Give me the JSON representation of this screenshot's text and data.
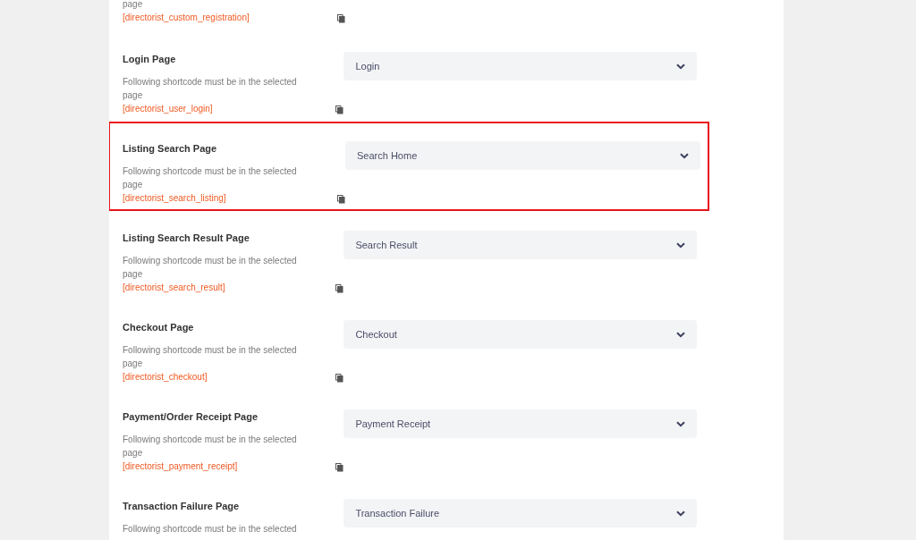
{
  "settings": [
    {
      "description": "page",
      "shortcode": "[directorist_custom_registration]",
      "highlighted": false
    },
    {
      "title": "Login Page",
      "description": "Following shortcode must be in the selected page",
      "shortcode": "[directorist_user_login]",
      "selected_page": "Login",
      "highlighted": false
    },
    {
      "title": "Listing Search Page",
      "description": "Following shortcode must be in the selected page",
      "shortcode": "[directorist_search_listing]",
      "selected_page": "Search Home",
      "highlighted": true
    },
    {
      "title": "Listing Search Result Page",
      "description": "Following shortcode must be in the selected page",
      "shortcode": "[directorist_search_result]",
      "selected_page": "Search Result",
      "highlighted": false
    },
    {
      "title": "Checkout Page",
      "description": "Following shortcode must be in the selected page",
      "shortcode": "[directorist_checkout]",
      "selected_page": "Checkout",
      "highlighted": false
    },
    {
      "title": "Payment/Order Receipt Page",
      "description": "Following shortcode must be in the selected page",
      "shortcode": "[directorist_payment_receipt]",
      "selected_page": "Payment Receipt",
      "highlighted": false
    },
    {
      "title": "Transaction Failure Page",
      "description": "Following shortcode must be in the selected",
      "selected_page": "Transaction Failure",
      "highlighted": false
    }
  ]
}
